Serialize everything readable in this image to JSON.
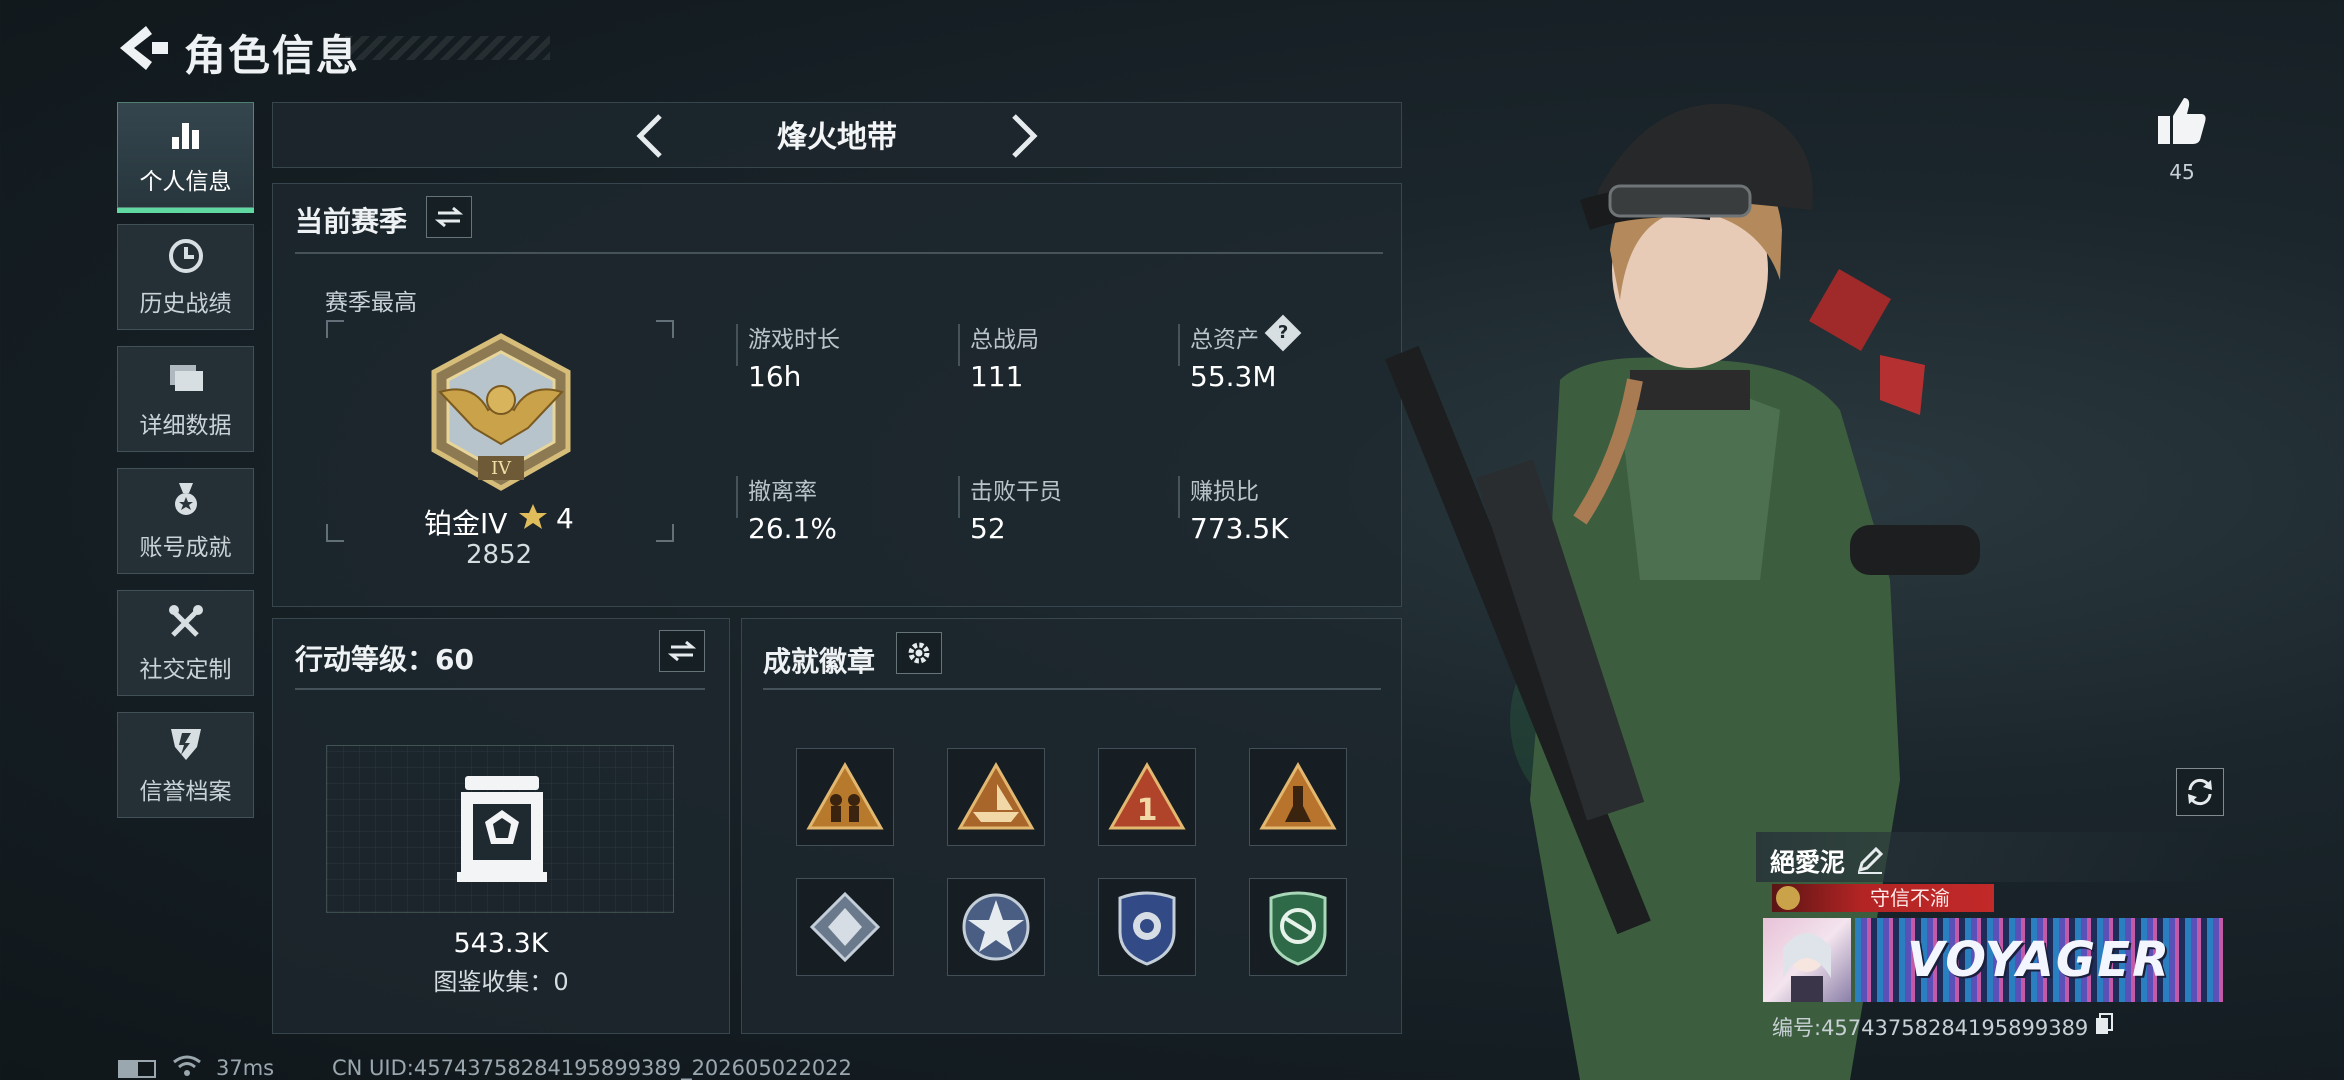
{
  "header": {
    "title": "角色信息"
  },
  "sidebar": {
    "items": [
      {
        "label": "个人信息",
        "icon": "bar-chart-icon",
        "active": true
      },
      {
        "label": "历史战绩",
        "icon": "history-clock-icon",
        "active": false
      },
      {
        "label": "详细数据",
        "icon": "folder-icon",
        "active": false
      },
      {
        "label": "账号成就",
        "icon": "medal-ribbon-icon",
        "active": false
      },
      {
        "label": "社交定制",
        "icon": "tools-icon",
        "active": false
      },
      {
        "label": "信誉档案",
        "icon": "reputation-shield-icon",
        "active": false
      }
    ]
  },
  "mode": {
    "title": "烽火地带"
  },
  "season": {
    "section_title": "当前赛季",
    "best_label": "赛季最高",
    "rank_name": "铂金IV",
    "rank_stars": "4",
    "rank_score": "2852",
    "rank_badge_text": "IV",
    "stats": [
      {
        "label": "游戏时长",
        "value": "16h"
      },
      {
        "label": "总战局",
        "value": "111"
      },
      {
        "label": "总资产",
        "value": "55.3M",
        "help": "?"
      },
      {
        "label": "撤离率",
        "value": "26.1%"
      },
      {
        "label": "击败干员",
        "value": "52"
      },
      {
        "label": "赚损比",
        "value": "773.5K"
      }
    ]
  },
  "action": {
    "title": "行动等级：60",
    "value": "543.3K",
    "collection": "图鉴收集：0"
  },
  "achievements": {
    "title": "成就徽章",
    "badges": [
      {
        "icon": "triangle-soldiers-badge-icon"
      },
      {
        "icon": "triangle-boat-badge-icon"
      },
      {
        "icon": "triangle-number-one-badge-icon",
        "text": "1"
      },
      {
        "icon": "triangle-tower-badge-icon"
      },
      {
        "icon": "diamond-card-badge-icon"
      },
      {
        "icon": "star-emblem-badge-icon"
      },
      {
        "icon": "police-shield-badge-icon"
      },
      {
        "icon": "green-shield-badge-icon"
      }
    ]
  },
  "footer": {
    "ping": "37ms",
    "uid": "CN UID:4574375828419589938​9_202605022022"
  },
  "profile": {
    "likes": "45",
    "name": "絕愛泥",
    "title": "守信不渝",
    "card_text": "VOYAGER",
    "id_text": "编号:4574375828419589938​9"
  },
  "colors": {
    "accent": "#5fd9a1",
    "title_banner": "#b32424",
    "gold": "#c9a24a",
    "background": "#141d22"
  }
}
